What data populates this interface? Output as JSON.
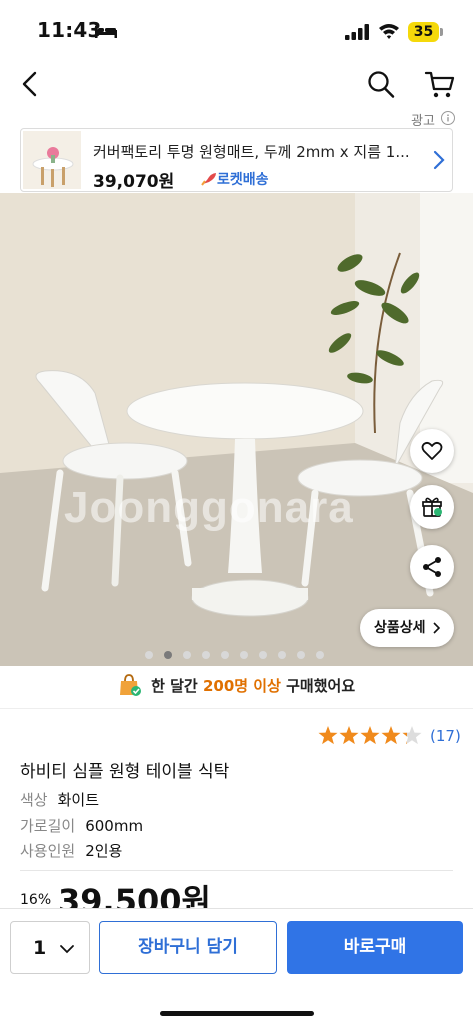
{
  "status_bar": {
    "time": "11:43",
    "battery": "35"
  },
  "ad": {
    "label": "광고",
    "title": "커버팩토리 투명 원형매트, 두께 2mm x 지름 1...",
    "price": "39,070원",
    "rocket_label": "로켓배송"
  },
  "image": {
    "watermark": "Joonggonara",
    "detail_button": "상품상세",
    "dot_count": 10,
    "active_dot": 1
  },
  "purchase": {
    "prefix": "한 달간",
    "highlight": "200명 이상",
    "suffix": "구매했어요"
  },
  "rating": {
    "stars": 4.5,
    "count": "(17)"
  },
  "product": {
    "title": "하비티 심플 원형 테이블 식탁",
    "options": [
      {
        "key": "색상",
        "value": "화이트"
      },
      {
        "key": "가로길이",
        "value": "600mm"
      },
      {
        "key": "사용인원",
        "value": "2인용"
      }
    ],
    "discount": "16%",
    "price": "39,500원"
  },
  "bottom": {
    "qty": "1",
    "cart_label": "장바구니 담기",
    "buy_label": "바로구매"
  },
  "colors": {
    "accent": "#3074e6",
    "rocket": "#2f6fd6",
    "highlight": "#e07000",
    "star": "#f08a1c"
  }
}
